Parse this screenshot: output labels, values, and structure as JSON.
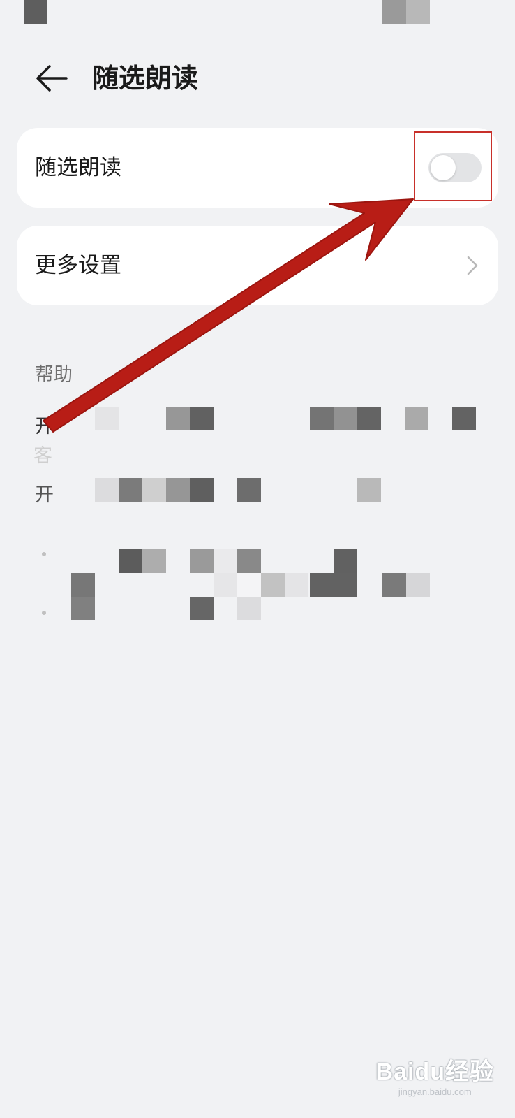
{
  "header": {
    "title": "随选朗读",
    "back_icon": "arrow-left-icon"
  },
  "toggle_card": {
    "label": "随选朗读",
    "toggle_state": "off"
  },
  "more_card": {
    "label": "更多设置",
    "chevron_icon": "chevron-right-icon"
  },
  "help": {
    "section_label": "帮助",
    "line1_start": "开",
    "line2_start": "客",
    "line3_start": "开"
  },
  "watermark": {
    "main": "Baidu经验",
    "sub": "jingyan.baidu.com"
  },
  "colors": {
    "background": "#f1f2f4",
    "card": "#ffffff",
    "annotation_red": "#c8302a",
    "arrow_red": "#b81d16"
  }
}
